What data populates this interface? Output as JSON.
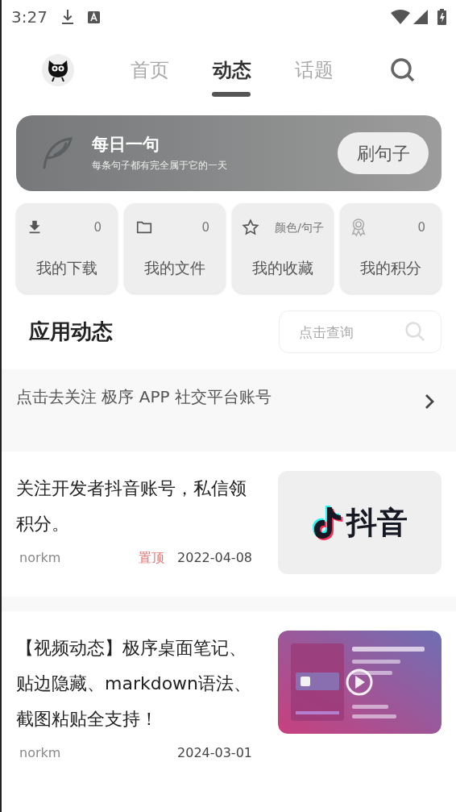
{
  "status_bar": {
    "time": "3:27"
  },
  "nav": {
    "tabs": [
      {
        "label": "首页",
        "selected": false
      },
      {
        "label": "动态",
        "selected": true
      },
      {
        "label": "话题",
        "selected": false
      }
    ]
  },
  "banner": {
    "title": "每日一句",
    "subtitle": "每条句子都有完全属于它的一天",
    "button": "刷句子"
  },
  "shortcuts": [
    {
      "kind": "download",
      "count": "0",
      "label": "我的下载"
    },
    {
      "kind": "folder",
      "count": "0",
      "label": "我的文件"
    },
    {
      "kind": "star",
      "count": "颜色/句子",
      "label": "我的收藏"
    },
    {
      "kind": "award",
      "count": "0",
      "label": "我的积分"
    }
  ],
  "section": {
    "title": "应用动态",
    "search_placeholder": "点击查询"
  },
  "follow_bar": {
    "text": "点击去关注 极序 APP 社交平台账号"
  },
  "posts": [
    {
      "title": "关注开发者抖音账号，私信领积分。",
      "author": "norkm",
      "pinned_label": "置顶",
      "date": "2022-04-08",
      "thumbnail": {
        "kind": "logo",
        "text": "抖音"
      }
    },
    {
      "title": "【视频动态】极序桌面笔记、贴边隐藏、markdown语法、截图粘贴全支持！",
      "author": "norkm",
      "date": "2024-03-01"
    }
  ]
}
